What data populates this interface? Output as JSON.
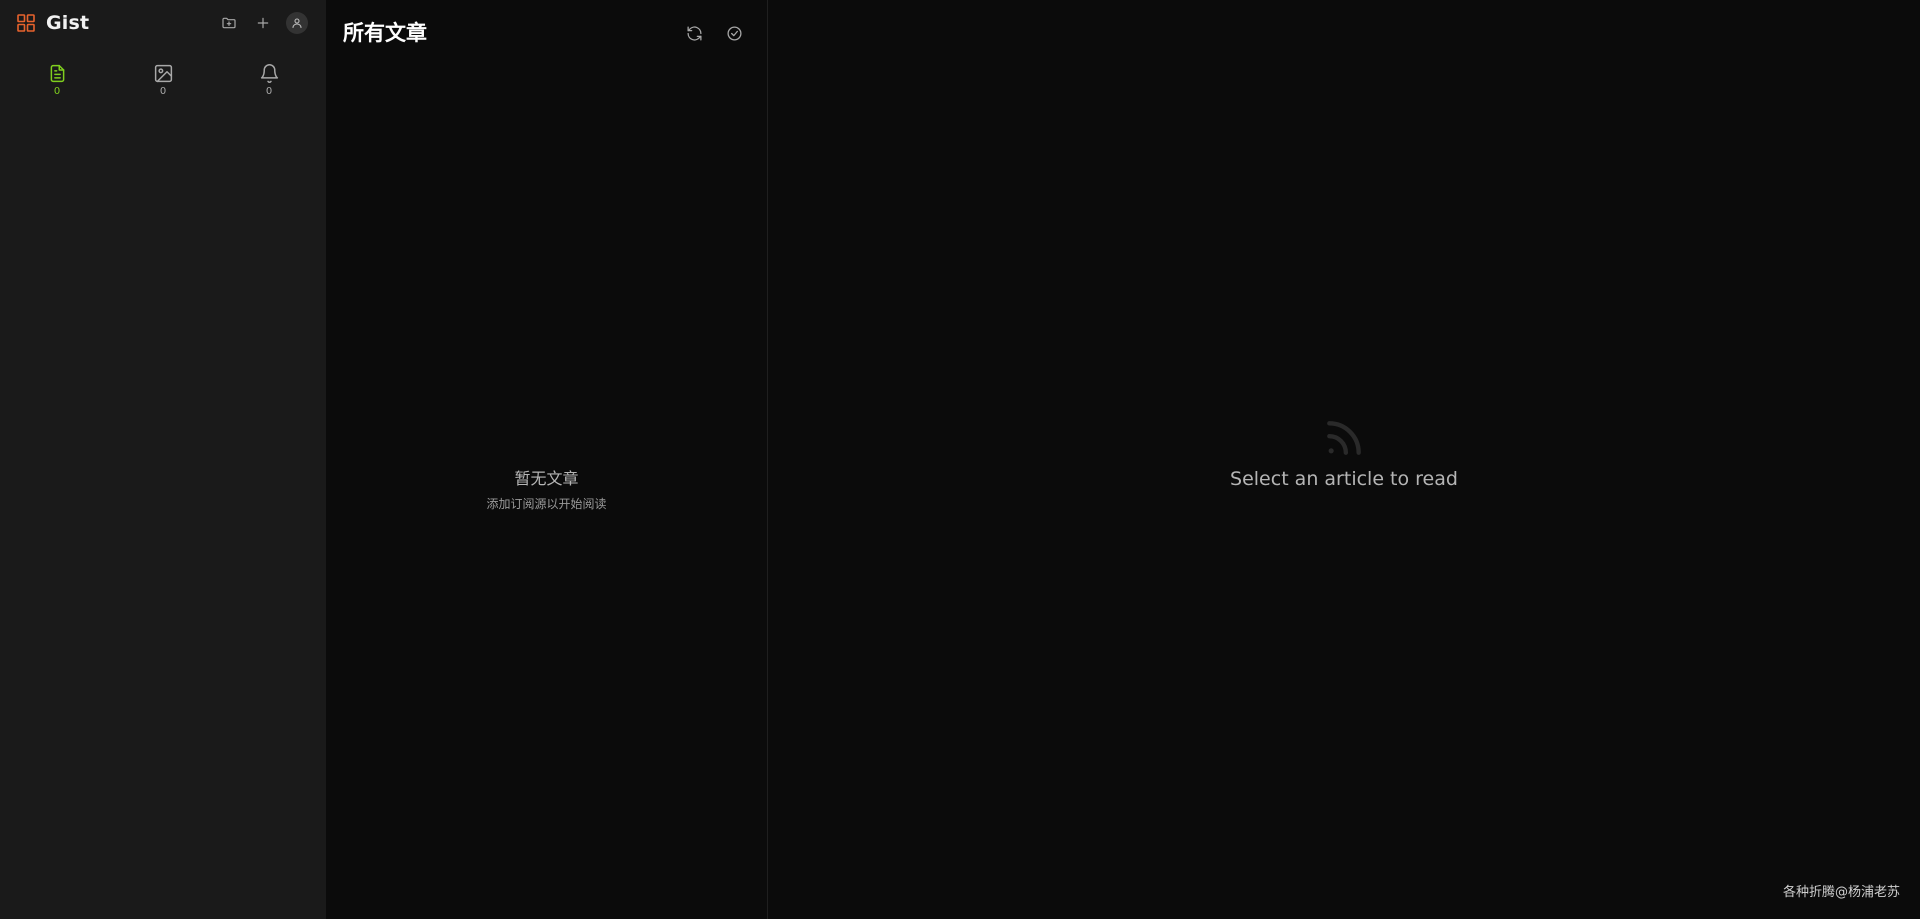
{
  "app": {
    "name": "Gist",
    "brand_color": "#e8632d"
  },
  "sidebar": {
    "header_icons": [
      "folder-plus-icon",
      "plus-icon",
      "user-avatar-icon"
    ],
    "stats": [
      {
        "icon": "article-icon",
        "count": "0",
        "active": true
      },
      {
        "icon": "image-icon",
        "count": "0",
        "active": false
      },
      {
        "icon": "bell-icon",
        "count": "0",
        "active": false
      }
    ],
    "active_color": "#7fcf1e"
  },
  "list": {
    "title": "所有文章",
    "actions": [
      "refresh-icon",
      "mark-all-read-icon"
    ],
    "empty_title": "暂无文章",
    "empty_subtitle": "添加订阅源以开始阅读"
  },
  "reader": {
    "placeholder_icon": "rss-icon",
    "placeholder_text": "Select an article to read"
  },
  "watermark": "各种折腾@杨浦老苏"
}
